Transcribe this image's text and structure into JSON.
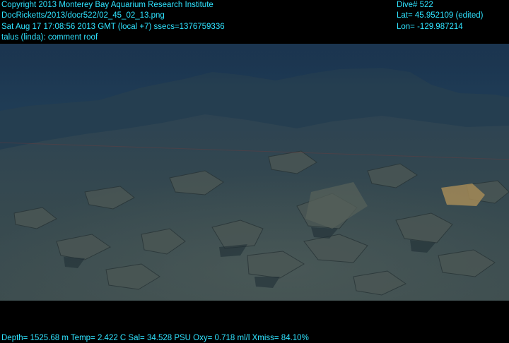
{
  "overlay": {
    "copyright": "Copyright 2013 Monterey Bay Aquarium Research Institute",
    "file_path": "DocRicketts/2013/docr522/02_45_02_13.png",
    "timestamp": "Sat Aug 17 17:08:56 2013 GMT (local +7)  ssecs=1376759336",
    "annotation": "talus (linda): comment roof",
    "dive": "Dive# 522",
    "latitude": "Lat= 45.952109 (edited)",
    "longitude": "Lon= -129.987214",
    "sensors": "Depth= 1525.68 m  Temp= 2.422 C  Sal= 34.528 PSU  Oxy= 0.718 ml/l  Xmiss= 84.10%"
  },
  "colors": {
    "overlay_text": "#2fe3ff",
    "water": "#1e3a52",
    "seafloor": "#3a4a4e"
  }
}
